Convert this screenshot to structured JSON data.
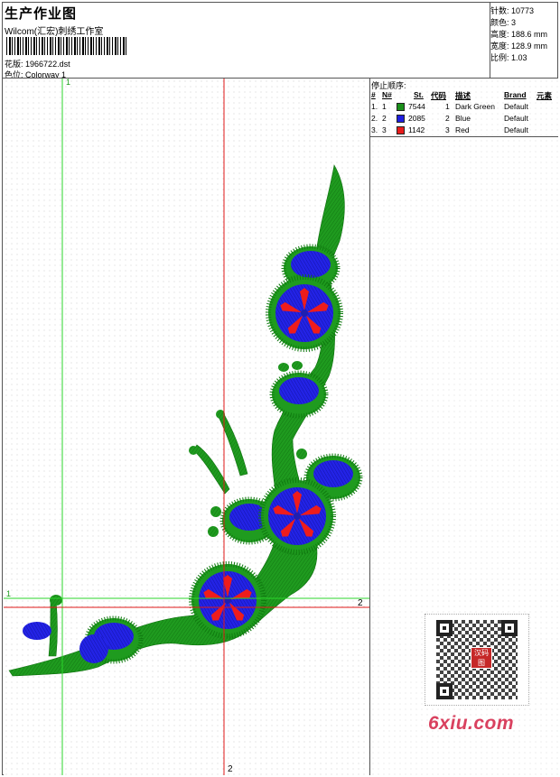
{
  "header": {
    "title": "生产作业图",
    "company": "Wilcom(汇宏)刺绣工作室",
    "design_label": "花版:",
    "design_value": "1966722.dst",
    "colorway_label": "色位:",
    "colorway_value": "Colorway 1"
  },
  "stats": [
    {
      "label": "针数:",
      "value": "10773"
    },
    {
      "label": "颜色:",
      "value": "3"
    },
    {
      "label": "高度:",
      "value": "188.6 mm"
    },
    {
      "label": "宽度:",
      "value": "128.9 mm"
    },
    {
      "label": "比例:",
      "value": "1.03"
    }
  ],
  "guides": {
    "green_v": "1",
    "green_h": "1",
    "red_h": "2",
    "red_v": "2",
    "colors": {
      "green": "#2bd62b",
      "red": "#e01818"
    }
  },
  "stop_sequence": {
    "caption": "停止顺序:",
    "headers": {
      "num": "#",
      "no": "N#",
      "st": "St.",
      "code": "代码",
      "desc": "描述",
      "brand": "Brand",
      "element": "元素"
    },
    "rows": [
      {
        "num": "1.",
        "no": "1",
        "color": "#1a8f1a",
        "st": "7544",
        "code": "1",
        "desc": "Dark Green",
        "brand": "Default"
      },
      {
        "num": "2.",
        "no": "2",
        "color": "#1f1fe0",
        "st": "2085",
        "code": "2",
        "desc": "Blue",
        "brand": "Default"
      },
      {
        "num": "3.",
        "no": "3",
        "color": "#e81c1c",
        "st": "1142",
        "code": "3",
        "desc": "Red",
        "brand": "Default"
      }
    ]
  },
  "qr": {
    "stamp": "汉码图"
  },
  "watermark": "6xiu.com"
}
